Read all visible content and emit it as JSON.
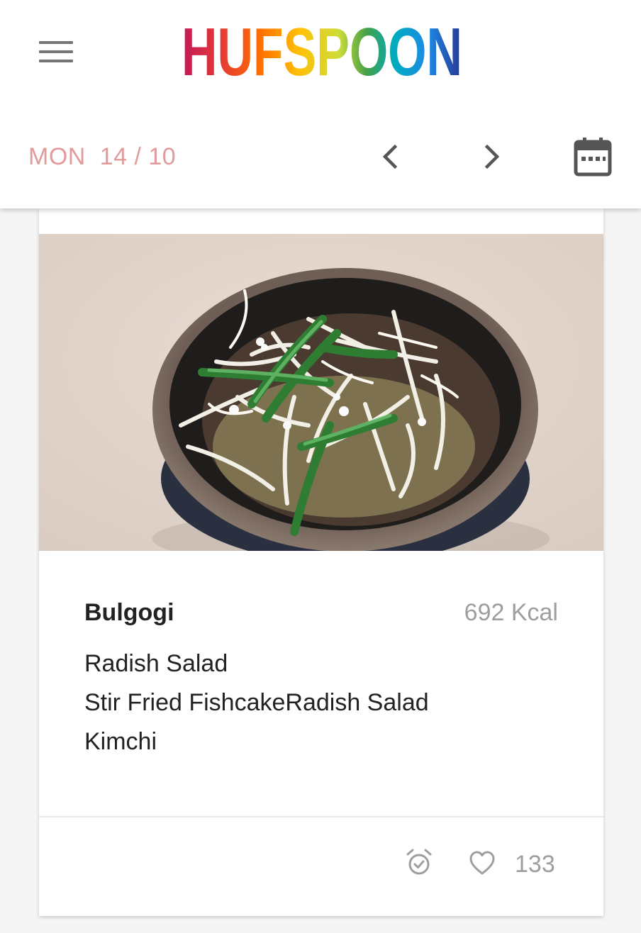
{
  "app": {
    "logo_text": "HUFSPOON"
  },
  "header": {
    "menu_icon": "hamburger-menu-icon",
    "date": {
      "day": "MON",
      "date": "14 / 10"
    },
    "prev_icon": "chevron-left-icon",
    "next_icon": "chevron-right-icon",
    "calendar_icon": "calendar-icon"
  },
  "meal": {
    "main_dish": "Bulgogi",
    "calories": "692 Kcal",
    "side_dishes": [
      "Radish Salad",
      "Stir Fried FishcakeRadish Salad",
      "Kimchi"
    ],
    "alarm_icon": "alarm-check-icon",
    "like_icon": "heart-outline-icon",
    "likes": "133"
  },
  "colors": {
    "date_text": "#e29b9b",
    "icon_gray": "#757575",
    "muted_text": "#9e9e9e",
    "logo_gradient": [
      "#c2185b",
      "#e53935",
      "#ff9800",
      "#ffeb3b",
      "#8bc34a",
      "#00acc1",
      "#1e88e5",
      "#283593"
    ]
  }
}
